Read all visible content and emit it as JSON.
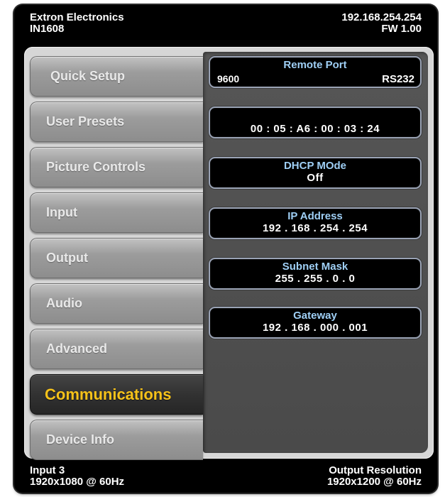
{
  "header": {
    "brand": "Extron Electronics",
    "model": "IN1608",
    "ip": "192.168.254.254",
    "firmware": "FW 1.00"
  },
  "tabs": [
    {
      "label": "Quick Setup"
    },
    {
      "label": "User Presets"
    },
    {
      "label": "Picture Controls"
    },
    {
      "label": "Input"
    },
    {
      "label": "Output"
    },
    {
      "label": "Audio"
    },
    {
      "label": "Advanced"
    },
    {
      "label": "Communications",
      "active": true
    },
    {
      "label": "Device Info"
    }
  ],
  "fields": {
    "remote_port": {
      "label": "Remote Port",
      "baud": "9600",
      "protocol": "RS232"
    },
    "mac": {
      "value": "00 : 05 : A6 : 00 : 03 : 24"
    },
    "dhcp": {
      "label": "DHCP MOde",
      "value": "Off"
    },
    "ip_address": {
      "label": "IP Address",
      "value": "192 . 168 . 254 . 254"
    },
    "subnet": {
      "label": "Subnet Mask",
      "value": "255 . 255 . 0 . 0"
    },
    "gateway": {
      "label": "Gateway",
      "value": "192 . 168 . 000 . 001"
    }
  },
  "footer": {
    "input_label": "Input 3",
    "input_res": "1920x1080 @ 60Hz",
    "output_label": "Output Resolution",
    "output_res": "1920x1200 @ 60Hz"
  },
  "colors": {
    "accent": "#f6c21a",
    "field_label": "#9fcff5"
  }
}
